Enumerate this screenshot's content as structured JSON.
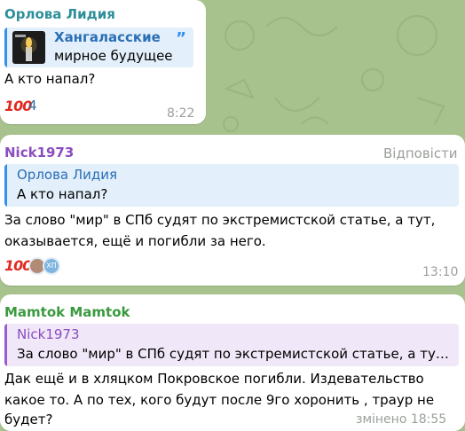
{
  "colors": {
    "background": "#a7c28c",
    "sender_orlova": "#2e8f9a",
    "sender_nick": "#8a4cbf",
    "sender_mamtok": "#3a9a3e",
    "reply_blue": "#3390ec",
    "reply_purple": "#9a5cd0",
    "reply_bg_blue": "#e3effa",
    "reply_bg_purple": "#f0e8f8",
    "time": "#9aa09a",
    "reaction_count": "#2f6ea5"
  },
  "messages": [
    {
      "sender": "Орлова Лидия",
      "forward": {
        "channel": "Хангаласские",
        "text": "мирное будущее",
        "quote_icon": "quote-icon",
        "thumbnail_icon": "candle-photo-icon"
      },
      "text": "А кто напал?",
      "reaction": {
        "emoji": "100",
        "emoji_icon": "hundred-points-icon",
        "count": "4"
      },
      "time": "8:22"
    },
    {
      "sender": "Nick1973",
      "action": "Відповісти",
      "reply_to": {
        "name": "Орлова Лидия",
        "text": "А кто напал?"
      },
      "text_lines": [
        "За слово \"мир\" в СПб судят по экстремистской статье, а тут,",
        "оказывается, ещё и погибли за него."
      ],
      "reaction": {
        "emoji": "100",
        "emoji_icon": "hundred-points-icon",
        "avatar_label": "ХП"
      },
      "time": "13:10"
    },
    {
      "sender": "Mamtok Mamtok",
      "reply_to": {
        "name": "Nick1973",
        "text": "За слово \"мир\" в СПб судят по экстремистской статье, а тут, о..."
      },
      "text_lines": [
        "Дак ещё и в хляцком Покровское погибли. Издевательство",
        "какое то. А по тех, кого будут после 9го хоронить , траур не",
        "будет?"
      ],
      "time": "змінено 18:55"
    }
  ]
}
